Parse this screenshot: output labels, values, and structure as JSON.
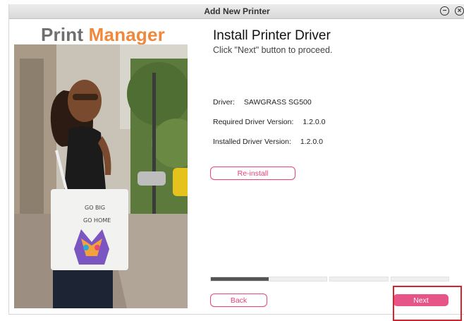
{
  "window": {
    "title": "Add New Printer"
  },
  "brand": {
    "part1": "Print",
    "part2": "Manager",
    "color_gray": "#6f6f6f",
    "color_orange": "#f0883c"
  },
  "content": {
    "heading": "Install Printer Driver",
    "subheading": "Click \"Next\" button to proceed.",
    "driver_label": "Driver:",
    "driver_value": "SAWGRASS SG500",
    "required_label": "Required Driver Version:",
    "required_value": "1.2.0.0",
    "installed_label": "Installed Driver Version:",
    "installed_value": "1.2.0.0"
  },
  "buttons": {
    "reinstall": "Re-install",
    "back": "Back",
    "next": "Next"
  },
  "progress": {
    "total_steps": 4,
    "progress_fraction": 0.245
  },
  "photo": {
    "bag_text_1": "GO BIG",
    "bag_text_2": "GO HOME"
  },
  "colors": {
    "accent_pink": "#e75487",
    "highlight_red": "#d6242a"
  }
}
